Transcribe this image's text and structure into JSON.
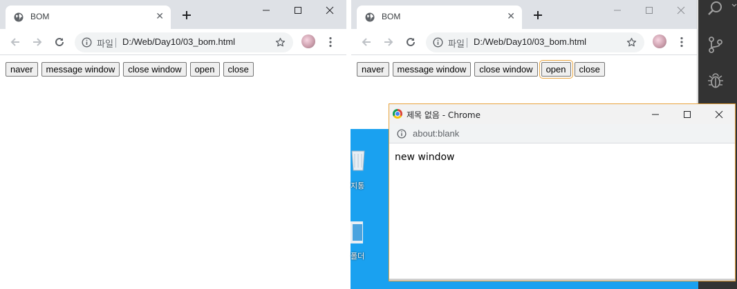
{
  "left_window": {
    "tab_title": "BOM",
    "omnibox": {
      "scheme_label": "파일",
      "url": "D:/Web/Day10/03_bom.html"
    },
    "buttons": [
      "naver",
      "message window",
      "close window",
      "open",
      "close"
    ]
  },
  "right_window": {
    "tab_title": "BOM",
    "omnibox": {
      "scheme_label": "파일",
      "url": "D:/Web/Day10/03_bom.html"
    },
    "buttons": [
      "naver",
      "message window",
      "close window",
      "open",
      "close"
    ],
    "focused_button": "open"
  },
  "popup": {
    "title": "제목 없음 - Chrome",
    "address": "about:blank",
    "body_text": "new window"
  },
  "desktop": {
    "icons": [
      {
        "name": "recycle-bin-icon",
        "label": "지통"
      },
      {
        "name": "folder-icon",
        "label": "폴더"
      }
    ]
  },
  "colors": {
    "tabstrip": "#dee1e6",
    "desktop": "#1aa1f0",
    "vscode_activity_bar": "#333333",
    "focus_ring": "#e8a33d"
  }
}
